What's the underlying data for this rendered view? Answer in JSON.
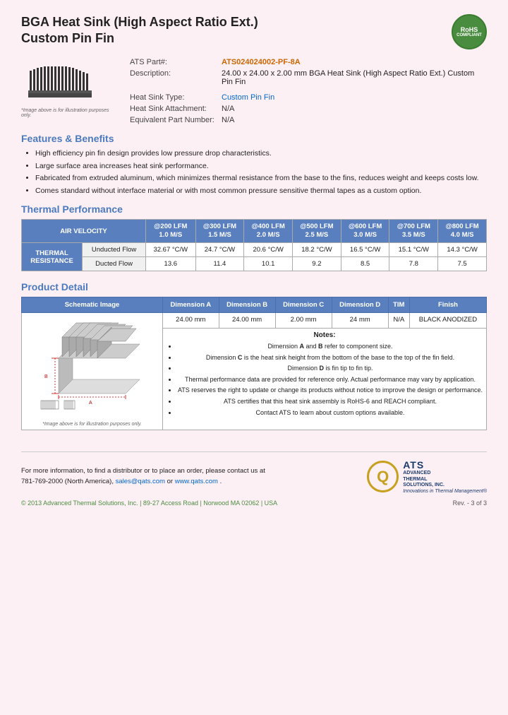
{
  "header": {
    "title_line1": "BGA Heat Sink (High Aspect Ratio Ext.)",
    "title_line2": "Custom Pin Fin",
    "rohs": "RoHS",
    "compliant": "COMPLIANT"
  },
  "part_info": {
    "ats_part_label": "ATS Part#:",
    "ats_part_value": "ATS024024002-PF-8A",
    "description_label": "Description:",
    "description_value": "24.00 x 24.00 x 2.00 mm  BGA Heat Sink (High Aspect Ratio Ext.) Custom Pin Fin",
    "heat_sink_type_label": "Heat Sink Type:",
    "heat_sink_type_value": "Custom Pin Fin",
    "attachment_label": "Heat Sink Attachment:",
    "attachment_value": "N/A",
    "equiv_part_label": "Equivalent Part Number:",
    "equiv_part_value": "N/A",
    "image_caption": "*Image above is for illustration purposes only."
  },
  "features": {
    "title": "Features & Benefits",
    "items": [
      "High efficiency pin fin design provides low pressure drop characteristics.",
      "Large surface area increases heat sink performance.",
      "Fabricated from extruded aluminum, which minimizes thermal resistance from the base to the fins, reduces weight and keeps costs low.",
      "Comes standard without interface material or with most common pressure sensitive thermal tapes as a custom option."
    ]
  },
  "thermal_performance": {
    "title": "Thermal Performance",
    "air_velocity_label": "AIR VELOCITY",
    "thermal_resistance_label": "THERMAL RESISTANCE",
    "columns": [
      {
        "lfm": "@200 LFM",
        "ms": "1.0 M/S"
      },
      {
        "lfm": "@300 LFM",
        "ms": "1.5 M/S"
      },
      {
        "lfm": "@400 LFM",
        "ms": "2.0 M/S"
      },
      {
        "lfm": "@500 LFM",
        "ms": "2.5 M/S"
      },
      {
        "lfm": "@600 LFM",
        "ms": "3.0 M/S"
      },
      {
        "lfm": "@700 LFM",
        "ms": "3.5 M/S"
      },
      {
        "lfm": "@800 LFM",
        "ms": "4.0 M/S"
      }
    ],
    "rows": [
      {
        "label": "Unducted Flow",
        "values": [
          "32.67 °C/W",
          "24.7 °C/W",
          "20.6 °C/W",
          "18.2 °C/W",
          "16.5 °C/W",
          "15.1 °C/W",
          "14.3 °C/W"
        ]
      },
      {
        "label": "Ducted Flow",
        "values": [
          "13.6",
          "11.4",
          "10.1",
          "9.2",
          "8.5",
          "7.8",
          "7.5"
        ]
      }
    ]
  },
  "product_detail": {
    "title": "Product Detail",
    "headers": [
      "Schematic Image",
      "Dimension A",
      "Dimension B",
      "Dimension C",
      "Dimension D",
      "TIM",
      "Finish"
    ],
    "row": [
      "24.00 mm",
      "24.00 mm",
      "2.00 mm",
      "24 mm",
      "N/A",
      "BLACK ANODIZED"
    ],
    "schematic_caption": "*Image above is for illustration purposes only.",
    "notes_title": "Notes:",
    "notes": [
      "Dimension A and B refer to component size.",
      "Dimension C is the heat sink height from the bottom of the base to the top of the fin field.",
      "Dimension D is fin tip to fin tip.",
      "Thermal performance data are provided for reference only. Actual performance may vary by application.",
      "ATS reserves the right to update or change its products without notice to improve the design or performance.",
      "ATS certifies that this heat sink assembly is RoHS-6 and REACH compliant.",
      "Contact ATS to learn about custom options available."
    ]
  },
  "footer": {
    "contact_line1": "For more information, to find a distributor or to place an order, please contact us at",
    "contact_line2": "781-769-2000 (North America), sales@qats.com or www.qats.com.",
    "copyright": "© 2013 Advanced Thermal Solutions, Inc.  |  89-27 Access Road  |  Norwood MA  02062  |  USA",
    "page_number": "Rev. - 3 of 3",
    "ats_main": "ATS",
    "ats_sub1": "ADVANCED",
    "ats_sub2": "THERMAL",
    "ats_sub3": "SOLUTIONS, INC.",
    "ats_tagline": "Innovations in Thermal Management®"
  }
}
